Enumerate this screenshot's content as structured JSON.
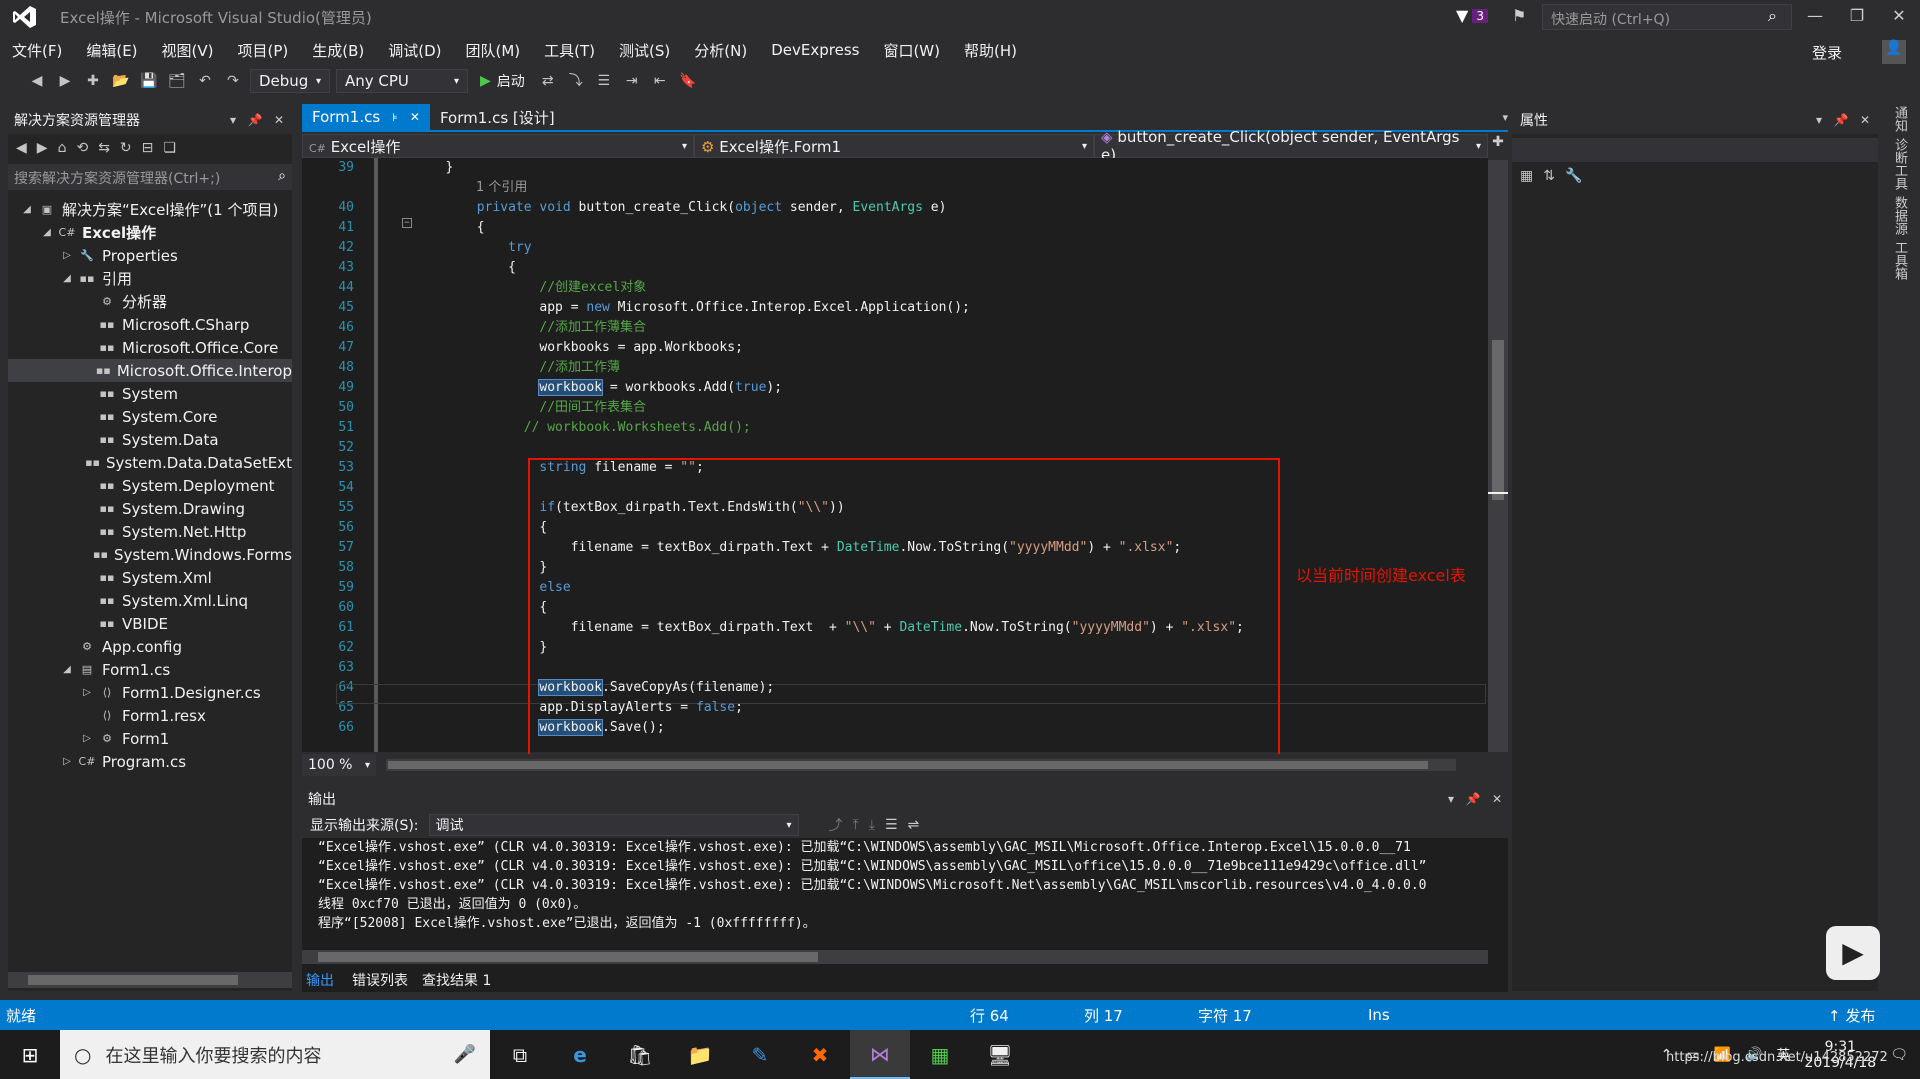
{
  "window": {
    "title": "Excel操作 - Microsoft Visual Studio(管理员)",
    "notif_count": "3",
    "quick_launch_placeholder": "快速启动 (Ctrl+Q)",
    "login": "登录"
  },
  "menu": [
    "文件(F)",
    "编辑(E)",
    "视图(V)",
    "项目(P)",
    "生成(B)",
    "调试(D)",
    "团队(M)",
    "工具(T)",
    "测试(S)",
    "分析(N)",
    "DevExpress",
    "窗口(W)",
    "帮助(H)"
  ],
  "toolbar": {
    "config": "Debug",
    "platform": "Any CPU",
    "start": "启动"
  },
  "solution_explorer": {
    "title": "解决方案资源管理器",
    "search_placeholder": "搜索解决方案资源管理器(Ctrl+;)",
    "items": [
      {
        "label": "解决方案“Excel操作”(1 个项目)",
        "indent": 0
      },
      {
        "label": "Excel操作",
        "indent": 1
      },
      {
        "label": "Properties",
        "indent": 2
      },
      {
        "label": "引用",
        "indent": 2
      },
      {
        "label": "分析器",
        "indent": 3
      },
      {
        "label": "Microsoft.CSharp",
        "indent": 3
      },
      {
        "label": "Microsoft.Office.Core",
        "indent": 3
      },
      {
        "label": "Microsoft.Office.Interop",
        "indent": 3
      },
      {
        "label": "System",
        "indent": 3
      },
      {
        "label": "System.Core",
        "indent": 3
      },
      {
        "label": "System.Data",
        "indent": 3
      },
      {
        "label": "System.Data.DataSetExt",
        "indent": 3
      },
      {
        "label": "System.Deployment",
        "indent": 3
      },
      {
        "label": "System.Drawing",
        "indent": 3
      },
      {
        "label": "System.Net.Http",
        "indent": 3
      },
      {
        "label": "System.Windows.Forms",
        "indent": 3
      },
      {
        "label": "System.Xml",
        "indent": 3
      },
      {
        "label": "System.Xml.Linq",
        "indent": 3
      },
      {
        "label": "VBIDE",
        "indent": 3
      },
      {
        "label": "App.config",
        "indent": 2
      },
      {
        "label": "Form1.cs",
        "indent": 2
      },
      {
        "label": "Form1.Designer.cs",
        "indent": 3
      },
      {
        "label": "Form1.resx",
        "indent": 3
      },
      {
        "label": "Form1",
        "indent": 3
      },
      {
        "label": "Program.cs",
        "indent": 2
      }
    ]
  },
  "tabs": [
    "Form1.cs",
    "Form1.cs [设计]"
  ],
  "nav": {
    "project": "Excel操作",
    "class": "Excel操作.Form1",
    "member": "button_create_Click(object sender, EventArgs e)"
  },
  "code": {
    "refs": "1 个引用",
    "line_numbers": [
      "39",
      "40",
      "41",
      "42",
      "43",
      "44",
      "45",
      "46",
      "47",
      "48",
      "49",
      "50",
      "51",
      "52",
      "53",
      "54",
      "55",
      "56",
      "57",
      "58",
      "59",
      "60",
      "61",
      "62",
      "63",
      "64",
      "65",
      "66"
    ],
    "l40": "private void button_create_Click(object sender, EventArgs e)",
    "c44": "//创建excel对象",
    "c46": "//添加工作薄集合",
    "c48": "//添加工作薄",
    "c50": "//田间工作表集合",
    "c51": "// workbook.Worksheets.Add();",
    "annotation": "以当前时间创建excel表"
  },
  "zoom": "100 %",
  "output": {
    "title": "输出",
    "source_label": "显示输出来源(S):",
    "source": "调试",
    "lines": [
      "“Excel操作.vshost.exe” (CLR v4.0.30319: Excel操作.vshost.exe): 已加载“C:\\WINDOWS\\assembly\\GAC_MSIL\\Microsoft.Office.Interop.Excel\\15.0.0.0__71",
      "“Excel操作.vshost.exe” (CLR v4.0.30319: Excel操作.vshost.exe): 已加载“C:\\WINDOWS\\assembly\\GAC_MSIL\\office\\15.0.0.0__71e9bce111e9429c\\office.dll”",
      "“Excel操作.vshost.exe” (CLR v4.0.30319: Excel操作.vshost.exe): 已加载“C:\\WINDOWS\\Microsoft.Net\\assembly\\GAC_MSIL\\mscorlib.resources\\v4.0_4.0.0.0",
      "线程 0xcf70 已退出，返回值为 0 (0x0)。",
      "程序“[52008] Excel操作.vshost.exe”已退出，返回值为 -1 (0xffffffff)。"
    ],
    "tabs": [
      "输出",
      "错误列表",
      "查找结果 1"
    ]
  },
  "properties": {
    "title": "属性"
  },
  "right_rail": [
    "通知",
    "诊断工具",
    "数据源",
    "工具箱"
  ],
  "status": {
    "ready": "就绪",
    "row": "行 64",
    "col": "列 17",
    "char": "字符 17",
    "ins": "Ins",
    "publish": "发布"
  },
  "taskbar": {
    "search": "在这里输入你要搜索的内容",
    "time": "9:31",
    "date": "2019/4/18",
    "ime": "英",
    "watermark": "https://blog.csdn.net/u142852272"
  }
}
